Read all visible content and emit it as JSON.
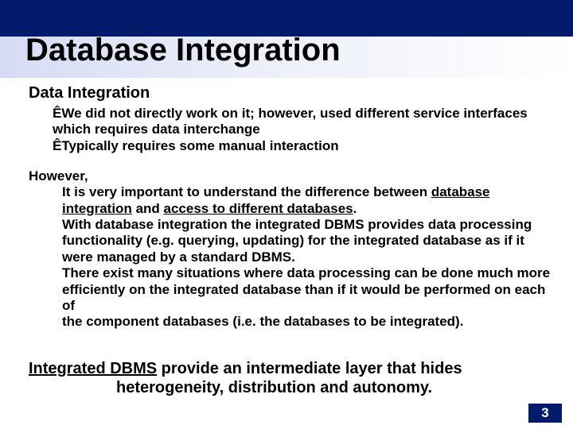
{
  "title": "Database Integration",
  "subheading": "Data Integration",
  "bullets": [
    "We did not directly work on it; however, used different service interfaces which requires data interchange",
    "Typically requires some manual interaction"
  ],
  "however_label": "However,",
  "para_line1_a": "It is very important to understand the difference between ",
  "para_line1_u1": "database integration",
  "para_line1_b": " and ",
  "para_line1_u2": "access to different databases",
  "para_line1_c": ".",
  "para_line2": "With database integration the integrated DBMS provides data processing functionality (e.g. querying, updating) for the integrated database as if it were managed by a standard DBMS.",
  "para_line3a": "There exist many situations where data processing can be done much more efficiently on the integrated database than if it would be performed on each of",
  "para_line3b": "the component databases (i.e. the databases to be integrated).",
  "summary_u": "Integrated DBMS",
  "summary_rest": " provide an intermediate layer that hides",
  "summary_line2": "heterogeneity, distribution and autonomy.",
  "page_number": "3",
  "bullet_glyph": "Ê"
}
